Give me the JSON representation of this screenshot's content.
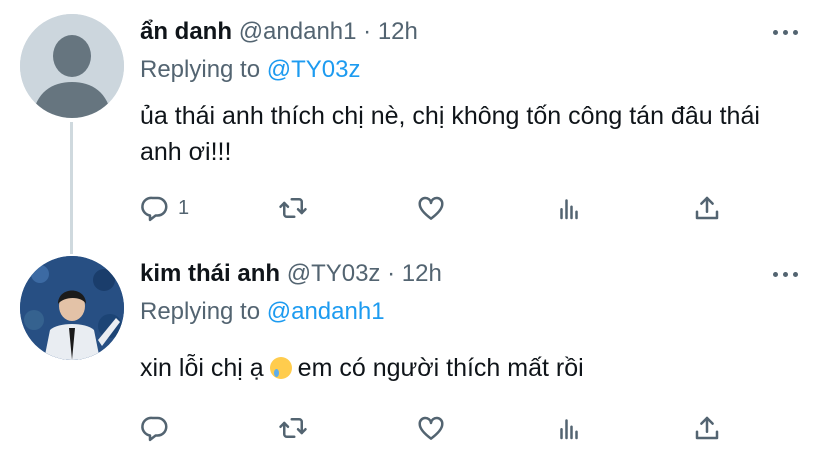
{
  "tweets": [
    {
      "display_name": "ẩn danh",
      "handle": "@andanh1",
      "time": "12h",
      "replying_prefix": "Replying to",
      "replying_to": "@TY03z",
      "text": "ủa thái anh thích chị nè, chị không tốn công tán đâu thái anh ơi!!!",
      "reply_count": "1",
      "avatar": "default-avatar"
    },
    {
      "display_name": "kim thái anh",
      "handle": "@TY03z",
      "time": "12h",
      "replying_prefix": "Replying to",
      "replying_to": "@andanh1",
      "text_before_emoji": "xin lỗi chị ạ",
      "emoji": "crying-face",
      "text_after_emoji": "em có người thích mất rồi",
      "reply_count": "",
      "avatar": "photo-avatar"
    }
  ],
  "separator": "·",
  "colors": {
    "accent": "#1d9bf0",
    "secondary": "#536471",
    "primary": "#0f1419",
    "thread_line": "#cfd9de"
  },
  "icons": [
    "reply-icon",
    "retweet-icon",
    "like-icon",
    "analytics-icon",
    "share-icon",
    "more-icon"
  ]
}
